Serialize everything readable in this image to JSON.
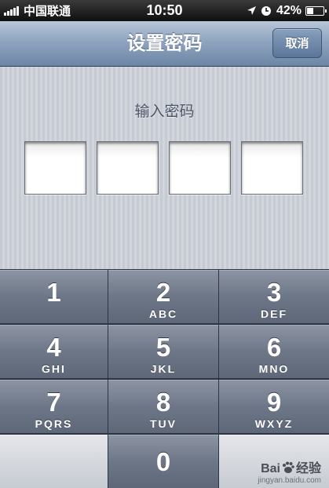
{
  "status_bar": {
    "carrier": "中国联通",
    "time": "10:50",
    "battery": "42%",
    "battery_level": 0.42
  },
  "nav": {
    "title": "设置密码",
    "cancel_label": "取消"
  },
  "pin": {
    "prompt": "输入密码",
    "digits_entered": 0,
    "length": 4
  },
  "keypad": {
    "keys": [
      {
        "digit": "1",
        "letters": ""
      },
      {
        "digit": "2",
        "letters": "ABC"
      },
      {
        "digit": "3",
        "letters": "DEF"
      },
      {
        "digit": "4",
        "letters": "GHI"
      },
      {
        "digit": "5",
        "letters": "JKL"
      },
      {
        "digit": "6",
        "letters": "MNO"
      },
      {
        "digit": "7",
        "letters": "PQRS"
      },
      {
        "digit": "8",
        "letters": "TUV"
      },
      {
        "digit": "9",
        "letters": "WXYZ"
      },
      {
        "digit": "0",
        "letters": ""
      }
    ]
  },
  "watermark": {
    "brand_left": "Bai",
    "brand_right": "经验",
    "url": "jingyan.baidu.com"
  }
}
